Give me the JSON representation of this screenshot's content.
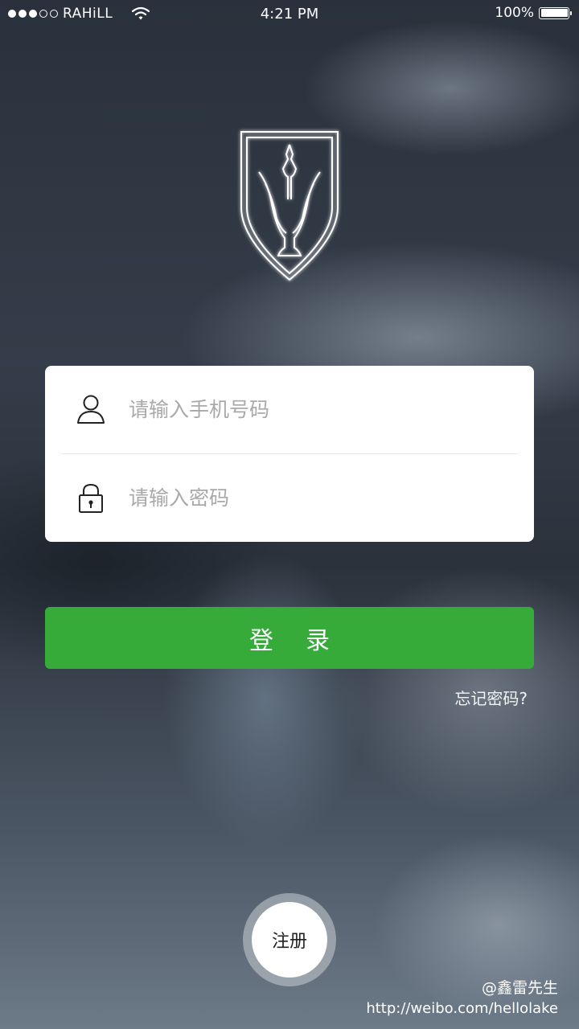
{
  "status_bar": {
    "carrier": "RAHiLL",
    "time": "4:21 PM",
    "battery": "100%",
    "signal_full": 3,
    "signal_empty": 2
  },
  "logo": {
    "icon": "shield-trophy-logo"
  },
  "login_form": {
    "phone": {
      "placeholder": "请输入手机号码",
      "value": "",
      "icon": "user-icon"
    },
    "password": {
      "placeholder": "请输入密码",
      "value": "",
      "icon": "lock-icon"
    }
  },
  "login_button": {
    "label": "登录"
  },
  "forgot_password": {
    "label": "忘记密码?"
  },
  "register_button": {
    "label": "注册"
  },
  "watermark": {
    "handle": "@鑫雷先生",
    "url": "http://weibo.com/hellolake"
  },
  "colors": {
    "accent_green": "#36ab3a",
    "card_bg": "#ffffff",
    "placeholder": "#a9a9a9"
  }
}
